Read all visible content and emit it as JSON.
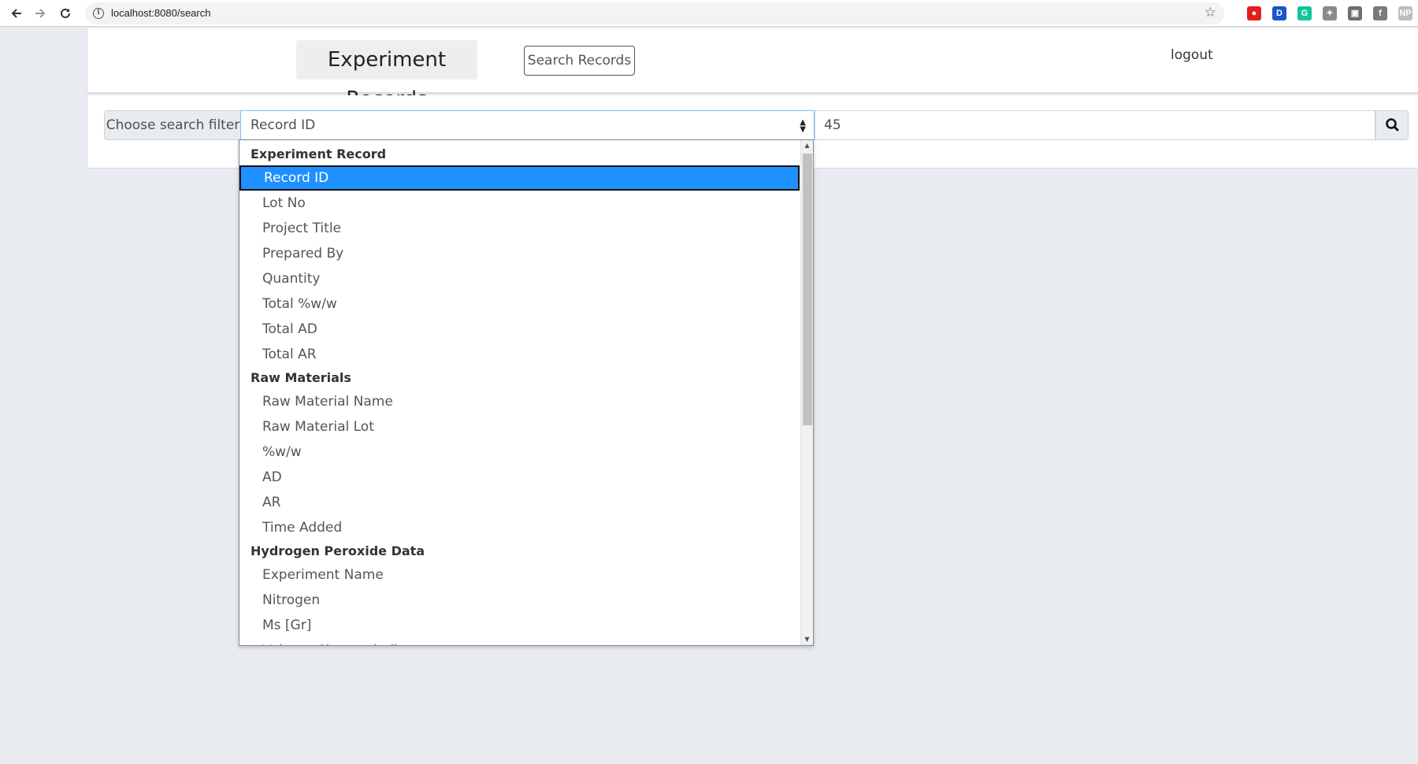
{
  "browser": {
    "url": "localhost:8080/search",
    "extensions": [
      {
        "name": "adblock-icon",
        "letter": "●",
        "color": "#e0201f"
      },
      {
        "name": "dashlane-icon",
        "letter": "D",
        "color": "#1a56c8"
      },
      {
        "name": "grammarly-icon",
        "letter": "G",
        "color": "#15c39a"
      },
      {
        "name": "lightbulb-icon",
        "letter": "✦",
        "color": "#8a8a8a"
      },
      {
        "name": "picture-in-picture-icon",
        "letter": "▣",
        "color": "#6e6e6e"
      },
      {
        "name": "facebook-icon",
        "letter": "f",
        "color": "#7a7a7a"
      },
      {
        "name": "np-icon",
        "letter": "NP",
        "color": "#bdbdbd"
      }
    ]
  },
  "header": {
    "brand": "Experiment Records",
    "search_button": "Search Records",
    "logout": "logout"
  },
  "search": {
    "filter_label": "Choose search filter",
    "selected_filter": "Record ID",
    "query_value": "45"
  },
  "dropdown": {
    "groups": [
      {
        "label": "Experiment Record",
        "items": [
          "Record ID",
          "Lot No",
          "Project Title",
          "Prepared By",
          "Quantity",
          "Total %w/w",
          "Total AD",
          "Total AR"
        ]
      },
      {
        "label": "Raw Materials",
        "items": [
          "Raw Material Name",
          "Raw Material Lot",
          "%w/w",
          "AD",
          "AR",
          "Time Added"
        ]
      },
      {
        "label": "Hydrogen Peroxide Data",
        "items": [
          "Experiment Name",
          "Nitrogen",
          "Ms [Gr]",
          "Volume Change (ml)"
        ]
      }
    ],
    "selected": "Record ID"
  },
  "colors": {
    "selection": "#1e90ff",
    "page_background": "#e8ebef"
  }
}
